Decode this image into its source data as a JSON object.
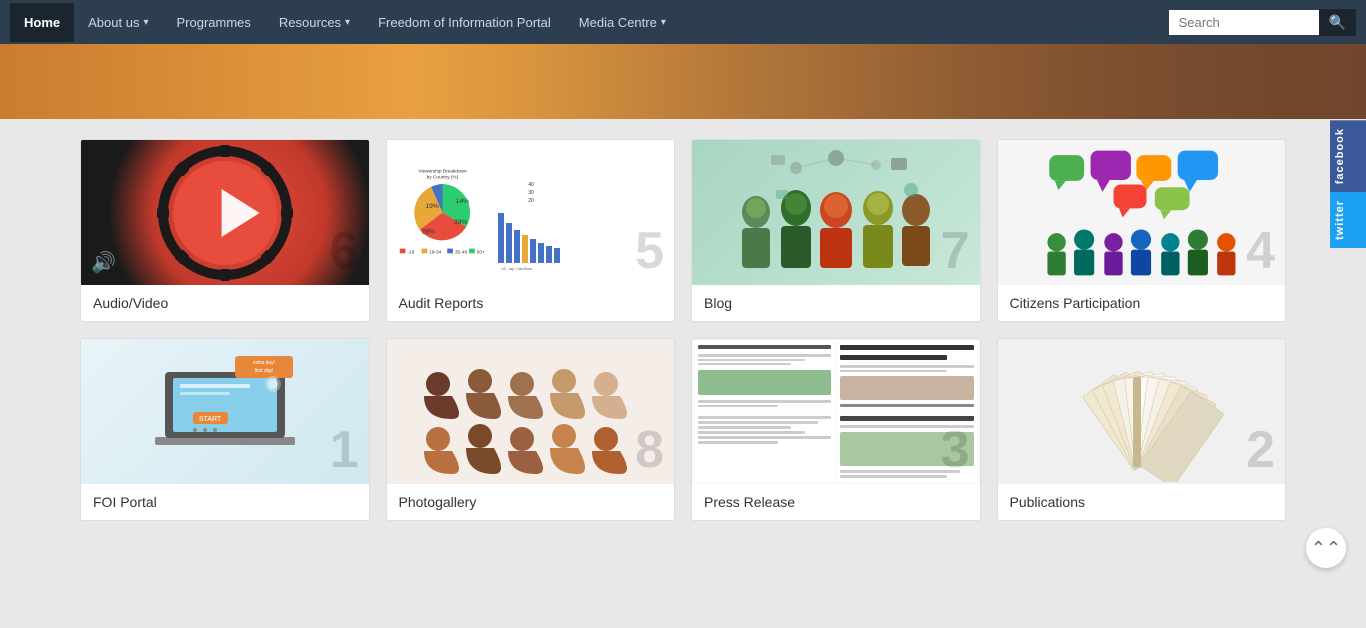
{
  "nav": {
    "items": [
      {
        "id": "home",
        "label": "Home",
        "active": true,
        "has_dropdown": false
      },
      {
        "id": "about",
        "label": "About us",
        "active": false,
        "has_dropdown": true
      },
      {
        "id": "programmes",
        "label": "Programmes",
        "active": false,
        "has_dropdown": false
      },
      {
        "id": "resources",
        "label": "Resources",
        "active": false,
        "has_dropdown": true
      },
      {
        "id": "foi",
        "label": "Freedom of Information Portal",
        "active": false,
        "has_dropdown": false
      },
      {
        "id": "media",
        "label": "Media Centre",
        "active": false,
        "has_dropdown": true
      }
    ],
    "search_placeholder": "Search"
  },
  "social": {
    "facebook_label": "facebook",
    "twitter_label": "twitter"
  },
  "cards_row1": [
    {
      "id": "audio-video",
      "label": "Audio/Video",
      "number": "6",
      "type": "av"
    },
    {
      "id": "audit-reports",
      "label": "Audit Reports",
      "number": "5",
      "type": "audit"
    },
    {
      "id": "blog",
      "label": "Blog",
      "number": "7",
      "type": "blog"
    },
    {
      "id": "citizens-participation",
      "label": "Citizens Participation",
      "number": "4",
      "type": "citizen"
    }
  ],
  "cards_row2": [
    {
      "id": "foi-portal",
      "label": "FOI Portal",
      "number": "1",
      "type": "foi"
    },
    {
      "id": "photogallery",
      "label": "Photogallery",
      "number": "8",
      "type": "photo"
    },
    {
      "id": "press-release",
      "label": "Press Release",
      "number": "3",
      "type": "press"
    },
    {
      "id": "publications",
      "label": "Publications",
      "number": "2",
      "type": "pub"
    }
  ],
  "chart": {
    "title": "Viewership Breakdown by Country (%)",
    "pie_segments": [
      {
        "label": "19%",
        "color": "#e8a838",
        "value": 19
      },
      {
        "label": "14%",
        "color": "#4472c4",
        "value": 14
      },
      {
        "label": "28%",
        "color": "#c0392b",
        "value": 28
      },
      {
        "label": "39%",
        "color": "#2ecc71",
        "value": 39
      }
    ],
    "bars": [
      40,
      28,
      22,
      18,
      15,
      12,
      10,
      9,
      8,
      7
    ],
    "legend": [
      "-18",
      "18-34",
      "35-49",
      "50+"
    ],
    "countries": [
      "US",
      "Japan",
      "Canada",
      "Brazil"
    ]
  },
  "people_colors_row1": [
    "#6b3a2a",
    "#8b5a3a",
    "#a0714f",
    "#c49a6c",
    "#d4b090",
    "#b87040",
    "#7a4a2a",
    "#9a6040",
    "#c4844c",
    "#b06030"
  ],
  "people_colors_row2": [
    "#8b6040",
    "#a07850",
    "#c49060",
    "#d4a870",
    "#e0b880",
    "#7a5030",
    "#9a6a40",
    "#b88050",
    "#9a7050",
    "#c4a060"
  ]
}
